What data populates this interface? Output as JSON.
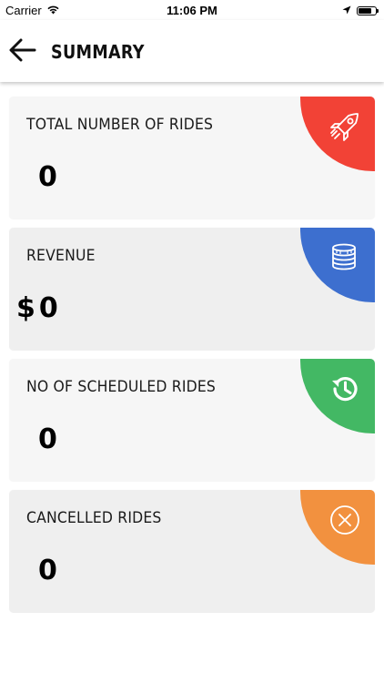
{
  "status_bar": {
    "carrier": "Carrier",
    "time": "11:06 PM",
    "battery_level": 0.75
  },
  "header": {
    "title": "SUMMARY",
    "back_icon": "arrow-left-icon"
  },
  "cards": [
    {
      "label": "TOTAL NUMBER OF RIDES",
      "value": "0",
      "currency": "",
      "icon": "rocket-icon",
      "color": "#f24236"
    },
    {
      "label": "REVENUE",
      "value": "0",
      "currency": "$",
      "icon": "coins-icon",
      "color": "#3d6fcf"
    },
    {
      "label": "NO OF SCHEDULED RIDES",
      "value": "0",
      "currency": "",
      "icon": "history-icon",
      "color": "#43b864"
    },
    {
      "label": "CANCELLED RIDES",
      "value": "0",
      "currency": "",
      "icon": "cancel-circle-icon",
      "color": "#f2913f"
    }
  ]
}
